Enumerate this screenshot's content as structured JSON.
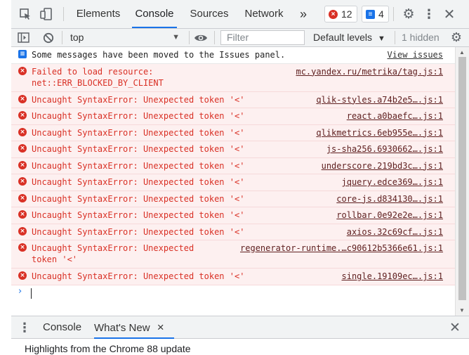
{
  "tabs": [
    "Elements",
    "Console",
    "Sources",
    "Network"
  ],
  "more_tabs_glyph": "»",
  "error_count": "12",
  "issues_count": "4",
  "toolbar": {
    "context": "top",
    "filter_placeholder": "Filter",
    "levels": "Default levels",
    "hidden": "1 hidden"
  },
  "messages": [
    {
      "type": "info",
      "text": "Some messages have been moved to the Issues panel.",
      "source": "View issues"
    },
    {
      "type": "error",
      "text": "Failed to load resource:\nnet::ERR_BLOCKED_BY_CLIENT",
      "source": "mc.yandex.ru/metrika/tag.js:1"
    },
    {
      "type": "error",
      "text": "Uncaught SyntaxError: Unexpected token '<'",
      "source": "qlik-styles.a74b2e5….js:1"
    },
    {
      "type": "error",
      "text": "Uncaught SyntaxError: Unexpected token '<'",
      "source": "react.a0baefc….js:1"
    },
    {
      "type": "error",
      "text": "Uncaught SyntaxError: Unexpected token '<'",
      "source": "qlikmetrics.6eb955e….js:1"
    },
    {
      "type": "error",
      "text": "Uncaught SyntaxError: Unexpected token '<'",
      "source": "js-sha256.6930662….js:1"
    },
    {
      "type": "error",
      "text": "Uncaught SyntaxError: Unexpected token '<'",
      "source": "underscore.219bd3c….js:1"
    },
    {
      "type": "error",
      "text": "Uncaught SyntaxError: Unexpected token '<'",
      "source": "jquery.edce369….js:1"
    },
    {
      "type": "error",
      "text": "Uncaught SyntaxError: Unexpected token '<'",
      "source": "core-js.d834130….js:1"
    },
    {
      "type": "error",
      "text": "Uncaught SyntaxError: Unexpected token '<'",
      "source": "rollbar.0e92e2e….js:1"
    },
    {
      "type": "error",
      "text": "Uncaught SyntaxError: Unexpected token '<'",
      "source": "axios.32c69cf….js:1"
    },
    {
      "type": "error",
      "text": "Uncaught SyntaxError: Unexpected\ntoken '<'",
      "source": "regenerator-runtime.…c90612b5366e61.js:1"
    },
    {
      "type": "error",
      "text": "Uncaught SyntaxError: Unexpected token '<'",
      "source": "single.19109ec….js:1"
    }
  ],
  "prompt_glyph": "›",
  "drawer": {
    "tabs": [
      "Console",
      "What's New"
    ],
    "close_glyph": "×",
    "highlights": "Highlights from the Chrome 88 update"
  },
  "colors": {
    "error": "#d93025",
    "accent": "#1a73e8",
    "error_bg": "#fdf0f0"
  }
}
